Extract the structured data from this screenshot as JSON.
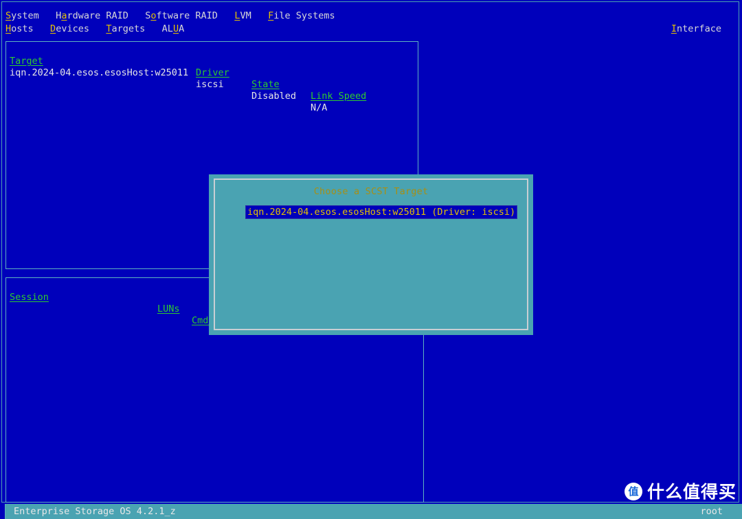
{
  "colors": {
    "screen_bg": "#0000bb",
    "panel_border": "#5fb3bf",
    "header_text": "#2ecc2e",
    "body_text": "#e6e6e6",
    "hotkey": "#e6c200",
    "dialog_bg": "#4aa3b2",
    "dialog_title": "#a88f14",
    "selection_bg": "#0000bb",
    "selection_fg": "#e6c200",
    "statusbar_bg": "#4aa3b2"
  },
  "menubar": {
    "row1": [
      {
        "name": "system",
        "pre": "",
        "hot": "S",
        "post": "ystem"
      },
      {
        "name": "hardware-raid",
        "pre": "H",
        "hot": "a",
        "post": "rdware RAID"
      },
      {
        "name": "software-raid",
        "pre": "S",
        "hot": "o",
        "post": "ftware RAID"
      },
      {
        "name": "lvm",
        "pre": "",
        "hot": "L",
        "post": "VM"
      },
      {
        "name": "file-systems",
        "pre": "",
        "hot": "F",
        "post": "ile Systems"
      }
    ],
    "row2": [
      {
        "name": "hosts",
        "pre": "",
        "hot": "H",
        "post": "osts"
      },
      {
        "name": "devices",
        "pre": "",
        "hot": "D",
        "post": "evices"
      },
      {
        "name": "targets",
        "pre": "",
        "hot": "T",
        "post": "argets"
      },
      {
        "name": "alua",
        "pre": "AL",
        "hot": "U",
        "post": "A"
      }
    ],
    "interface": {
      "pre": "",
      "hot": "I",
      "post": "nterface"
    }
  },
  "targets_panel": {
    "headers": {
      "target": "Target",
      "driver": "Driver",
      "state": "State",
      "link_speed": "Link Speed"
    },
    "rows": [
      {
        "target": "iqn.2024-04.esos.esosHost:w25011",
        "driver": "iscsi",
        "state": "Disabled",
        "link_speed": "N/A"
      }
    ]
  },
  "sessions_panel": {
    "headers": {
      "session": "Session",
      "luns": "LUNs",
      "cmds": "Cmds"
    },
    "rows": []
  },
  "dialog": {
    "title": "Choose a SCST Target",
    "items": [
      {
        "label": "iqn.2024-04.esos.esosHost:w25011 (Driver: iscsi)",
        "selected": true
      }
    ]
  },
  "statusbar": {
    "left": "Enterprise Storage OS 4.2.1_z",
    "right": "root"
  },
  "watermark": {
    "logo_glyph": "值",
    "text": "什么值得买"
  }
}
